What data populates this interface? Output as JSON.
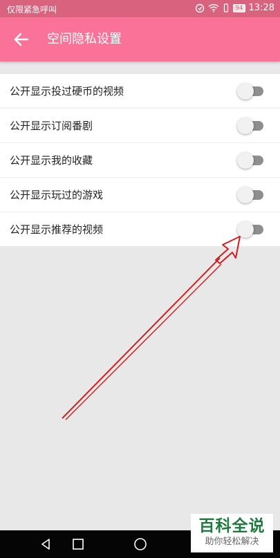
{
  "status_bar": {
    "carrier_text": "仅限紧急呼叫",
    "battery_level": "94",
    "time": "13:28"
  },
  "app_bar": {
    "title": "空间隐私设置",
    "back_icon": "arrow-left-icon"
  },
  "settings": [
    {
      "label": "公开显示投过硬币的视频",
      "enabled": false
    },
    {
      "label": "公开显示订阅番剧",
      "enabled": false
    },
    {
      "label": "公开显示我的收藏",
      "enabled": false
    },
    {
      "label": "公开显示玩过的游戏",
      "enabled": false
    },
    {
      "label": "公开显示推荐的视频",
      "enabled": false
    }
  ],
  "nav_bar": {
    "back_icon": "triangle-back-icon",
    "home_icon": "circle-home-icon",
    "recent_icon": "square-recent-icon"
  },
  "watermark": {
    "title": "百科全说",
    "subtitle": "助你轻松解决"
  },
  "colors": {
    "accent": "#fb7299",
    "status_bar": "#d9627f",
    "annotation_arrow": "#d21e1e",
    "toggle_track_off": "#8e8e8e",
    "toggle_thumb_off": "#f1f1f1"
  }
}
